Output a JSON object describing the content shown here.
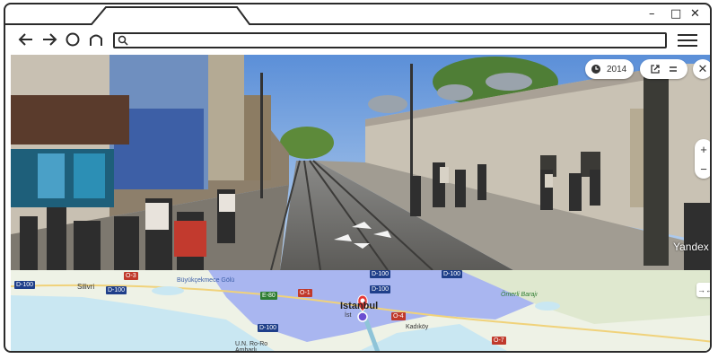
{
  "browser": {
    "window_controls": {
      "minimize": "–",
      "maximize": "□",
      "close": "✕"
    },
    "nav": {
      "back_icon": "arrow-left-icon",
      "forward_icon": "arrow-right-icon",
      "reload_icon": "reload-circle-icon",
      "home_icon": "home-icon"
    },
    "address": {
      "value": "",
      "placeholder": ""
    }
  },
  "panorama": {
    "year_label": "2014",
    "zoom_in": "+",
    "zoom_out": "−",
    "brand": "Yandex",
    "close_symbol": "✕"
  },
  "map": {
    "city": "Istanbul",
    "city_sub": "İst",
    "places": [
      "Silivri",
      "Büyükçekmece Gölü",
      "Ömerli Barajı",
      "U.N. Ro-Ro Ambarlı Limanı",
      "Kadıköy"
    ],
    "roads": [
      "D-100",
      "D-100",
      "O-3",
      "E-80",
      "D-100",
      "O-1",
      "D-100",
      "O-4",
      "D-100",
      "O-7",
      "D-100"
    ],
    "expand_symbol": "→←"
  },
  "colors": {
    "sky": "#7fb0e6",
    "map_water": "#c9e7f2",
    "map_land": "#eef2e6",
    "map_urban": "#a9b6f0",
    "marker": "#e53935"
  }
}
